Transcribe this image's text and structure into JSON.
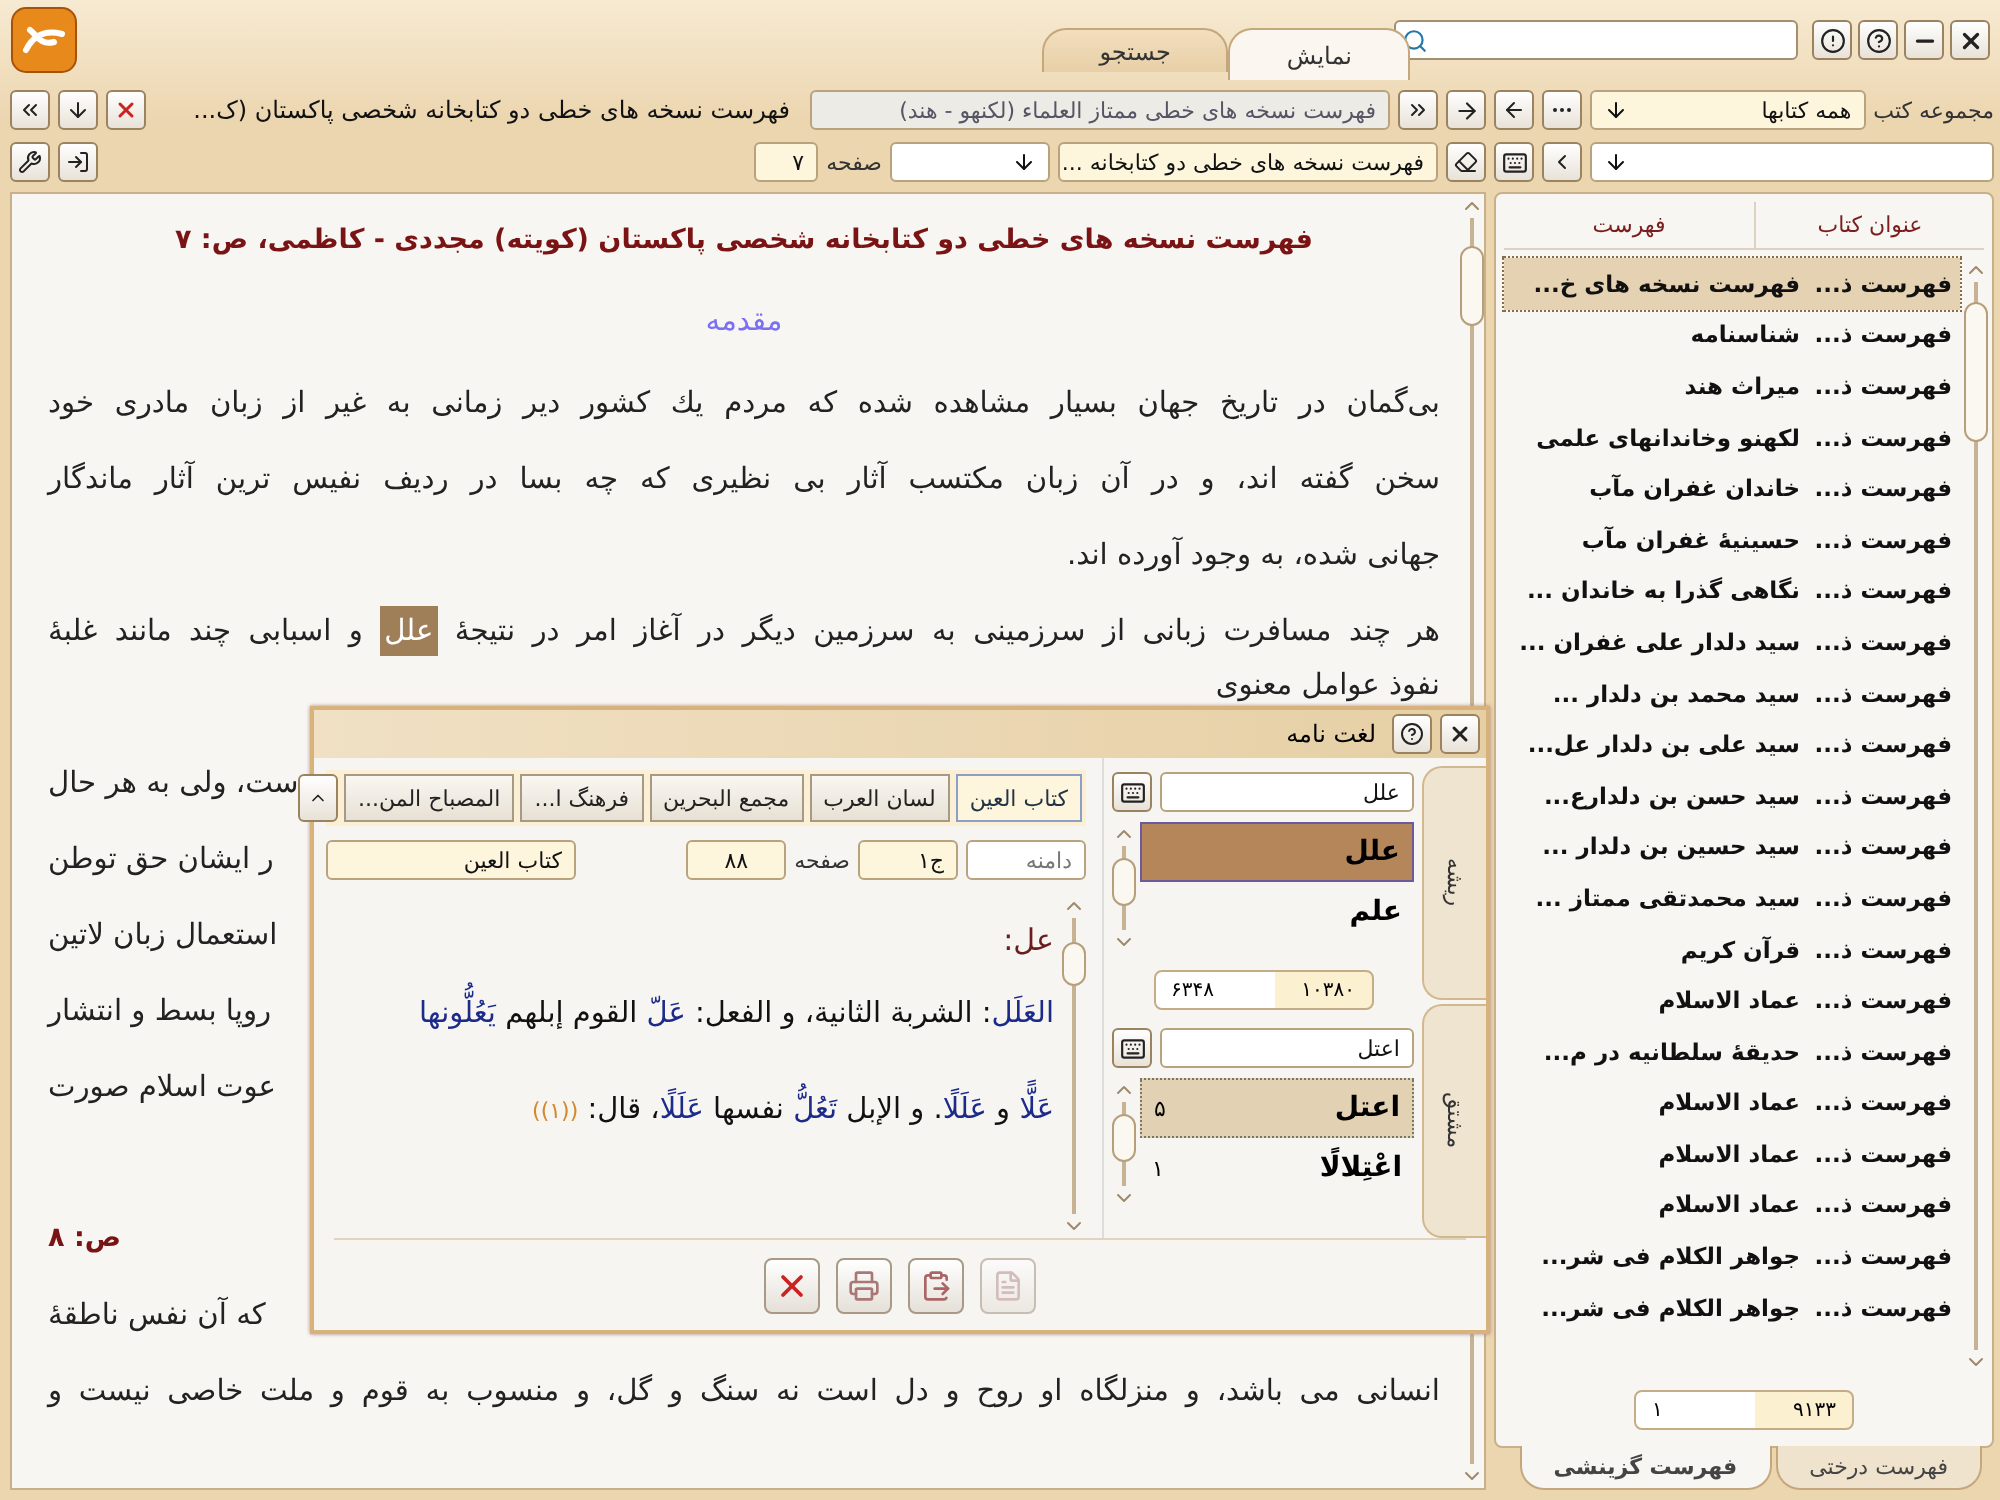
{
  "top_bar": {
    "tabs": [
      {
        "label": "نمایش",
        "selected": true
      },
      {
        "label": "جستجو",
        "selected": false
      }
    ]
  },
  "main": {
    "toolbar": {
      "history": "فهرست نسخه های خطی ممتاز العلماء (لکنهو - هند)",
      "current": "فهرست نسخه های خطی دو کتابخانه شخصی پاکستان (ک...",
      "section": "فهرست نسخه های خطی دو کتابخانه ...",
      "page_label": "صفحه",
      "page": "۷"
    },
    "lines": [
      {
        "kind": "title",
        "text": "فهرست نسخه های خطی دو کتابخانه شخصی پاکستان (کویته) مجددی - کاظمی، ص: ۷"
      },
      {
        "kind": "section",
        "text": "مقدمه"
      },
      {
        "kind": "text",
        "text": "بی‌گمان در تاریخ جهان بسیار مشاهده شده که مردم یك کشور دیر زمانی به غیر از زبان مادری خود"
      },
      {
        "kind": "text",
        "text": "سخن گفته اند، و در آن زبان مکتسب آثار بی نظیری که چه بسا در ردیف نفیس ترین آثار ماندگار"
      },
      {
        "kind": "text-end",
        "text": "جهانی شده، به وجود آورده اند."
      },
      {
        "kind": "marked",
        "parts": [
          {
            "text": "هر چند مسافرت زبانی از سرزمینی به سرزمین دیگر در آغاز امر در نتیجهٔ ",
            "highlighted": false
          },
          {
            "text": "علل",
            "highlighted": true
          },
          {
            "text": " و اسبابی چند مانند غلبهٔ",
            "highlighted": false
          }
        ]
      },
      {
        "kind": "fragment-end",
        "text": "نفوذ عوامل معنوی"
      },
      {
        "kind": "fragment",
        "text": "ست، ولی به هر حال"
      },
      {
        "kind": "fragment",
        "text": "ر ایشان حق توطن"
      },
      {
        "kind": "fragment",
        "text": "استعمال زبان لاتین"
      },
      {
        "kind": "fragment",
        "text": "روپا بسط و انتشار"
      },
      {
        "kind": "fragment",
        "text": "عوت اسلام صورت"
      },
      {
        "kind": "covered"
      },
      {
        "kind": "fragment-title",
        "text": "ص: ۸"
      },
      {
        "kind": "fragment",
        "text": "که آن نفس ناطقهٔ"
      },
      {
        "kind": "text",
        "text": "انسانی می باشد، و منزلگاه او روح و دل است نه سنگ و گل، و منسوب به قوم و ملت خاصی نیست و"
      }
    ]
  },
  "sidebar": {
    "collection_label": "مجموعه کتب",
    "collection": "همه کتابها",
    "columns": [
      "عنوان کتاب",
      "فهرست"
    ],
    "rows": [
      {
        "title": "فهرست ذ...",
        "index": "فهرست نسخه های خ...",
        "selected": true
      },
      {
        "title": "فهرست ذ...",
        "index": "شناسنامه",
        "selected": false
      },
      {
        "title": "فهرست ذ...",
        "index": "میراث هند",
        "selected": false
      },
      {
        "title": "فهرست ذ...",
        "index": "لکهنو وخاندانهای علمی",
        "selected": false
      },
      {
        "title": "فهرست ذ...",
        "index": "خاندان غفران مآب",
        "selected": false
      },
      {
        "title": "فهرست ذ...",
        "index": "حسینیهٔ غفران مآب",
        "selected": false
      },
      {
        "title": "فهرست ذ...",
        "index": "نگاهی گذرا به خاندان ...",
        "selected": false
      },
      {
        "title": "فهرست ذ...",
        "index": "سید دلدار علی غفران ...",
        "selected": false
      },
      {
        "title": "فهرست ذ...",
        "index": "سید محمد بن دلدار ...",
        "selected": false
      },
      {
        "title": "فهرست ذ...",
        "index": "سید علی بن دلدار عل...",
        "selected": false
      },
      {
        "title": "فهرست ذ...",
        "index": "سید حسن بن دلدارع...",
        "selected": false
      },
      {
        "title": "فهرست ذ...",
        "index": "سید حسین بن دلدار ...",
        "selected": false
      },
      {
        "title": "فهرست ذ...",
        "index": "سید محمدتقی ممتاز ...",
        "selected": false
      },
      {
        "title": "فهرست ذ...",
        "index": "قرآن کریم",
        "selected": false
      },
      {
        "title": "فهرست ذ...",
        "index": "عماد الاسلام",
        "selected": false
      },
      {
        "title": "فهرست ذ...",
        "index": "حدیقهٔ سلطانیه در م...",
        "selected": false
      },
      {
        "title": "فهرست ذ...",
        "index": "عماد الاسلام",
        "selected": false
      },
      {
        "title": "فهرست ذ...",
        "index": "عماد الاسلام",
        "selected": false
      },
      {
        "title": "فهرست ذ...",
        "index": "عماد الاسلام",
        "selected": false
      },
      {
        "title": "فهرست ذ...",
        "index": "جواهر الکلام فی شر...",
        "selected": false
      },
      {
        "title": "فهرست ذ...",
        "index": "جواهر الکلام فی شر...",
        "selected": false
      }
    ],
    "counter": {
      "total": "۹۱۳۳",
      "current": "۱"
    },
    "tabs": [
      {
        "label": "فهرست درختی",
        "selected": false
      },
      {
        "label": "فهرست گزینشی",
        "selected": true
      }
    ]
  },
  "dictionary": {
    "title": "لغت نامه",
    "side_tabs": [
      "ریشه",
      "مشتق"
    ],
    "root": {
      "value": "علل",
      "items": [
        {
          "word": "علل",
          "selected": true
        },
        {
          "word": "علم",
          "selected": false
        }
      ],
      "counter": {
        "total": "۱۰۳۸۰",
        "current": "۶۳۴۸"
      }
    },
    "derived": {
      "value": "اعتل",
      "items": [
        {
          "word": "اعتل",
          "count": "۵",
          "selected": true
        },
        {
          "word": "اعْتِلالًا",
          "count": "۱",
          "selected": false
        }
      ]
    },
    "books": [
      {
        "label": "کتاب العین",
        "selected": true
      },
      {
        "label": "لسان العرب",
        "selected": false
      },
      {
        "label": "مجمع البحرین",
        "selected": false
      },
      {
        "label": "فرهنگ ا...",
        "selected": false
      },
      {
        "label": "المصباح المن...",
        "selected": false
      }
    ],
    "info": {
      "scope": "دامنه",
      "volume": "ج۱",
      "page_label": "صفحه",
      "page": "۸۸",
      "book": "کتاب العین"
    },
    "entry": {
      "heading": "عل:",
      "lines": [
        [
          {
            "kind": "term",
            "text": "العَلَل"
          },
          {
            "kind": "plain",
            "text": ": الشربة الثانية، و الفعل: "
          },
          {
            "kind": "term",
            "text": "عَلّ"
          },
          {
            "kind": "plain",
            "text": " القوم إبلهم "
          },
          {
            "kind": "term",
            "text": "يَعُلُّونها"
          }
        ],
        [
          {
            "kind": "term",
            "text": "عَلًّا"
          },
          {
            "kind": "plain",
            "text": " و "
          },
          {
            "kind": "term",
            "text": "عَلَلًا"
          },
          {
            "kind": "plain",
            "text": ". و الإبل "
          },
          {
            "kind": "term",
            "text": "تَعُلُّ"
          },
          {
            "kind": "plain",
            "text": " نفسها "
          },
          {
            "kind": "term",
            "text": "عَلَلًا"
          },
          {
            "kind": "plain",
            "text": "، قال: "
          },
          {
            "kind": "note",
            "text": "((۱))"
          }
        ]
      ]
    }
  }
}
